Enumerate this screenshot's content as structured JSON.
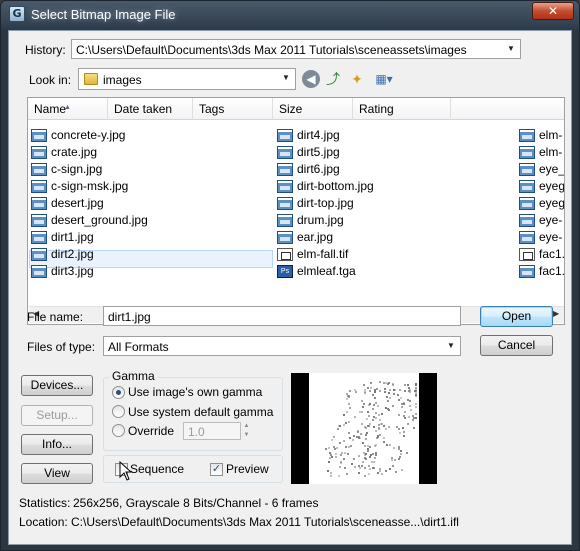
{
  "window": {
    "title": "Select Bitmap Image File",
    "close_glyph": "✕",
    "icon_glyph": "G"
  },
  "history": {
    "label": "History:",
    "value": "C:\\Users\\Default\\Documents\\3ds Max 2011 Tutorials\\sceneassets\\images"
  },
  "lookin": {
    "label": "Look in:",
    "value": "images"
  },
  "columns": [
    "Name",
    "Date taken",
    "Tags",
    "Size",
    "Rating"
  ],
  "files_col1": [
    "concrete-y.jpg",
    "crate.jpg",
    "c-sign.jpg",
    "c-sign-msk.jpg",
    "desert.jpg",
    "desert_ground.jpg",
    "dirt1.jpg",
    "dirt2.jpg",
    "dirt3.jpg"
  ],
  "files_col2": [
    "dirt4.jpg",
    "dirt5.jpg",
    "dirt6.jpg",
    "dirt-bottom.jpg",
    "dirt-top.jpg",
    "drum.jpg",
    "ear.jpg",
    "elm-fall.tif",
    "elmleaf.tga"
  ],
  "files_col3": [
    "elm-",
    "elm-",
    "eye_",
    "eyeg",
    "eyeg",
    "eye-",
    "eye-",
    "fac1.",
    "fac1."
  ],
  "selected_file_index": 6,
  "filename": {
    "label": "File name:",
    "value": "dirt1.jpg"
  },
  "filetype": {
    "label": "Files of type:",
    "value": "All Formats"
  },
  "buttons": {
    "open": "Open",
    "cancel": "Cancel",
    "devices": "Devices...",
    "setup": "Setup...",
    "info": "Info...",
    "view": "View"
  },
  "gamma": {
    "title": "Gamma",
    "options": [
      "Use image's own gamma",
      "Use system default gamma",
      "Override"
    ],
    "selected": 0,
    "override_value": "1.0"
  },
  "sequence": {
    "label": "Sequence",
    "checked": false
  },
  "preview_check": {
    "label": "Preview",
    "checked": true
  },
  "statistics": {
    "label": "Statistics:",
    "value": "256x256, Grayscale 8 Bits/Channel - 6 frames"
  },
  "location": {
    "label": "Location:",
    "value": "C:\\Users\\Default\\Documents\\3ds Max 2011 Tutorials\\sceneasse...\\dirt1.ifl"
  },
  "colors": {
    "selection": "#eaf3fd",
    "title_bar": "#2d3b4a",
    "close": "#c44d2f"
  }
}
